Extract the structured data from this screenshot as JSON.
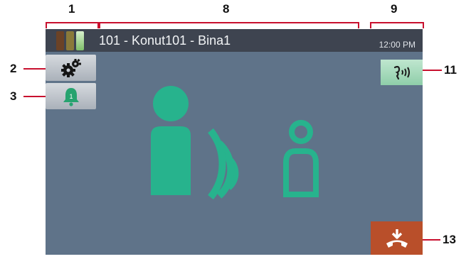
{
  "callouts": {
    "n1": "1",
    "n2": "2",
    "n3": "3",
    "n8": "8",
    "n9": "9",
    "n11": "11",
    "n13": "13"
  },
  "header": {
    "title": "101 - Konut101 - Bina1",
    "time": "12:00 PM",
    "signal_icon": "signal-strength-icon"
  },
  "buttons": {
    "settings_icon": "gears-icon",
    "alarm_icon": "bell-icon",
    "alarm_badge": "1",
    "voice_icon": "talk-icon",
    "end_call_icon": "hang-up-icon"
  },
  "illustration": {
    "icon": "intercom-call-icon"
  },
  "colors": {
    "screen_bg": "#5f7389",
    "topbar_bg": "#3e4450",
    "accent_green": "#27b38d",
    "end_call": "#b94f2a",
    "callout_line": "#c8102e"
  }
}
